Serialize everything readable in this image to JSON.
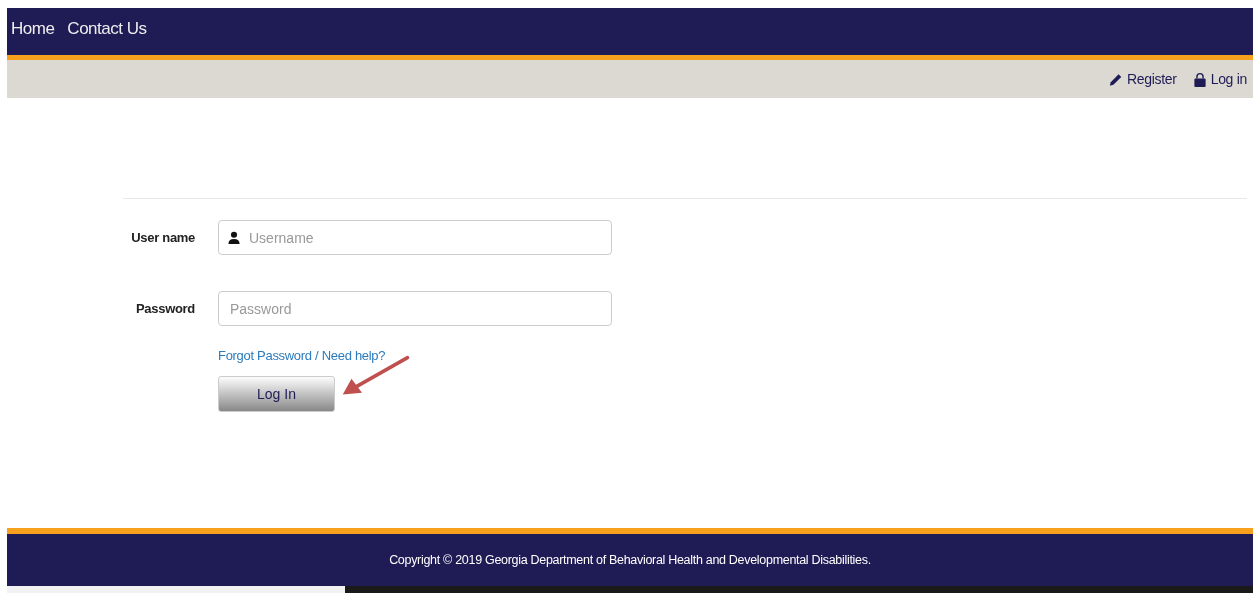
{
  "nav": {
    "links": [
      "Home",
      "Contact Us"
    ]
  },
  "account_bar": {
    "links": [
      {
        "label": "Register",
        "kind": "register"
      },
      {
        "label": "Log in",
        "kind": "login"
      }
    ]
  },
  "form": {
    "fields": [
      {
        "label": "User name",
        "placeholder": "Username",
        "kind": "user"
      },
      {
        "label": "Password",
        "placeholder": "Password",
        "kind": "password"
      }
    ],
    "help_link": "Forgot Password / Need help?",
    "submit": "Log In"
  },
  "footer": {
    "copyright": "Copyright © 2019 Georgia Department of Behavioral Health and Developmental Disabilities."
  }
}
